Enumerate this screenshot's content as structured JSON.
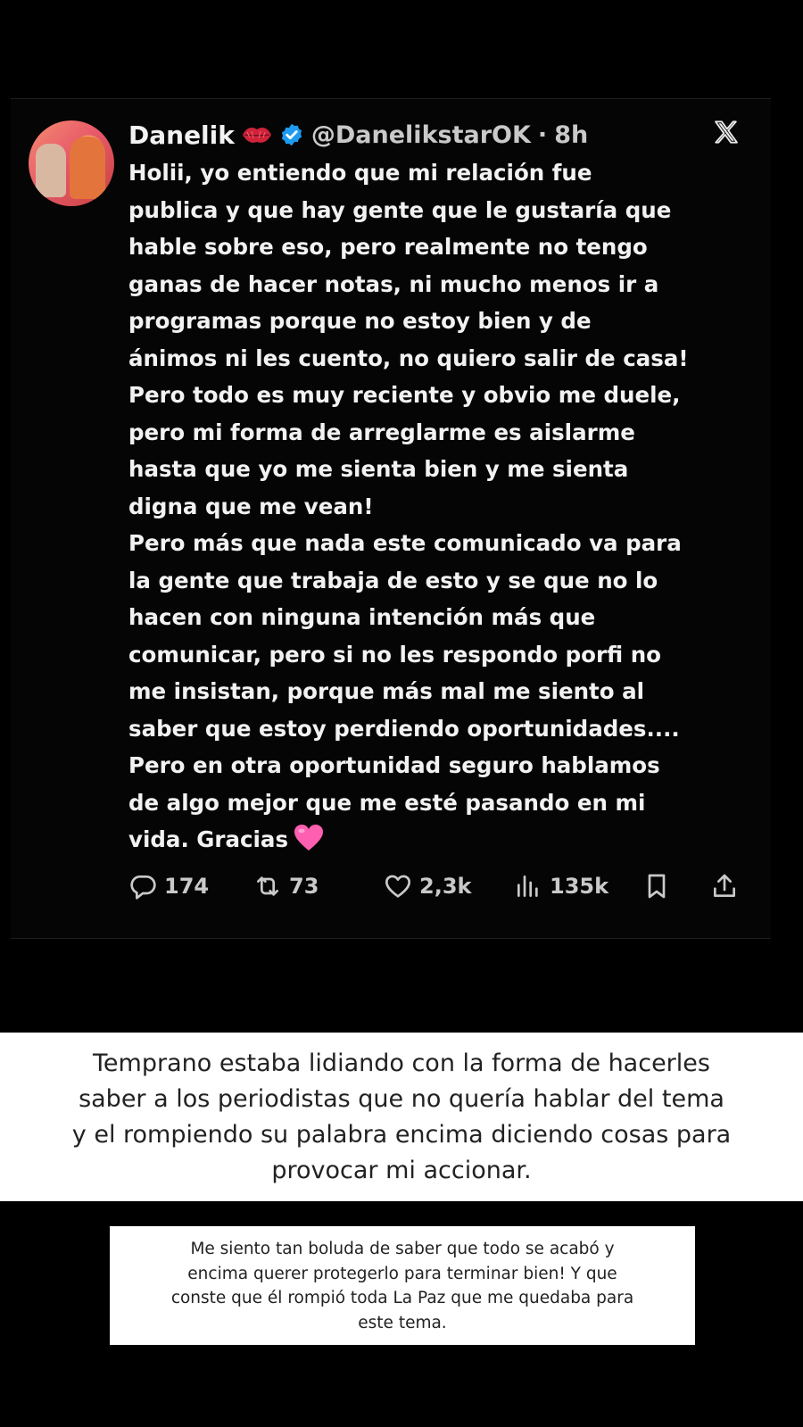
{
  "tweet": {
    "display_name": "Danelik",
    "handle": "@DanelikstarOK",
    "separator": "·",
    "time": "8h",
    "text_lines": [
      "Holii, yo entiendo que mi relación fue",
      "publica y que hay gente que le gustaría que",
      "hable sobre eso, pero realmente no tengo",
      "ganas de hacer notas, ni mucho menos ir a",
      "programas porque no estoy bien y de",
      "ánimos ni les cuento, no quiero salir de casa!",
      "Pero todo es muy reciente y obvio me duele,",
      "pero mi forma de arreglarme es aislarme",
      "hasta que yo me sienta bien y me sienta",
      "digna que me vean!",
      "Pero más que nada este comunicado va para",
      "la gente que trabaja de esto y se que no lo",
      "hacen con ninguna intención más que",
      "comunicar, pero si no les respondo porfi no",
      "me insistan, porque más mal me siento al",
      "saber que estoy perdiendo oportunidades....",
      "Pero en otra oportunidad seguro hablamos",
      "de algo mejor que me esté pasando en mi",
      "vida. Gracias"
    ],
    "stats": {
      "replies": "174",
      "reposts": "73",
      "likes": "2,3k",
      "views": "135k"
    },
    "icons": {
      "name_emoji": "lips-icon",
      "verified": "verified-badge-icon",
      "platform": "x-logo-icon",
      "end_emoji": "pink-heart-icon"
    },
    "colors": {
      "verified_blue": "#1d9bf0",
      "heart_pink": "#ff5fb0",
      "lips_red": "#d0233a"
    }
  },
  "caption_top": {
    "lines": [
      "Temprano estaba lidiando con la forma de hacerles",
      "saber a los periodistas que no quería hablar del tema",
      "y el rompiendo su palabra encima diciendo cosas para",
      "provocar mi accionar."
    ]
  },
  "caption_bottom": {
    "lines": [
      "Me siento tan boluda de saber que todo se acabó y",
      "encima querer protegerlo para terminar bien! Y que",
      "conste que él rompió toda La Paz que me quedaba para",
      "este tema."
    ]
  }
}
